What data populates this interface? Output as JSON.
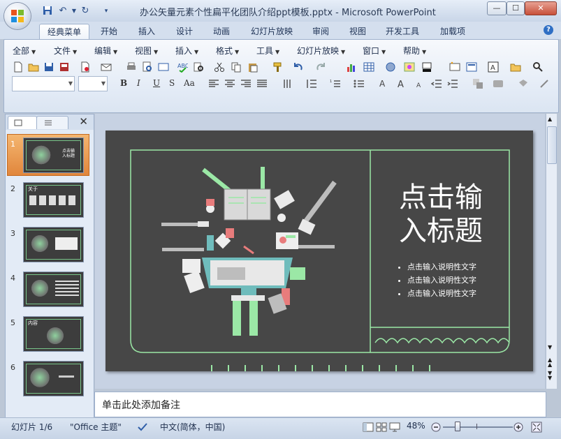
{
  "window": {
    "title": "办公矢量元素个性扁平化团队介绍ppt模板.pptx - Microsoft PowerPoint",
    "controls": {
      "minimize": "—",
      "maximize": "☐",
      "close": "✕"
    }
  },
  "tabs": [
    "经典菜单",
    "开始",
    "插入",
    "设计",
    "动画",
    "幻灯片放映",
    "审阅",
    "视图",
    "开发工具",
    "加载项"
  ],
  "menu": [
    "全部",
    "文件",
    "编辑",
    "视图",
    "插入",
    "格式",
    "工具",
    "幻灯片放映",
    "窗口",
    "帮助"
  ],
  "format_buttons": {
    "bold": "B",
    "italic": "I",
    "underline": "U",
    "strike": "S",
    "case": "Aa"
  },
  "slides": [
    {
      "number": "1",
      "selected": true
    },
    {
      "number": "2",
      "label": "关于"
    },
    {
      "number": "3"
    },
    {
      "number": "4"
    },
    {
      "number": "5",
      "label": "内容"
    },
    {
      "number": "6"
    }
  ],
  "slide": {
    "title_line1": "点击输",
    "title_line2": "入标题",
    "bullets": [
      "点击输入说明性文字",
      "点击输入说明性文字",
      "点击输入说明性文字"
    ],
    "colors": {
      "background": "#474747",
      "accent": "#9be8a6"
    }
  },
  "thumb_title": "点击输入标题",
  "notes_placeholder": "单击此处添加备注",
  "status": {
    "slide_counter": "幻灯片 1/6",
    "theme": "\"Office 主题\"",
    "language": "中文(简体，中国)",
    "zoom": "48%"
  }
}
